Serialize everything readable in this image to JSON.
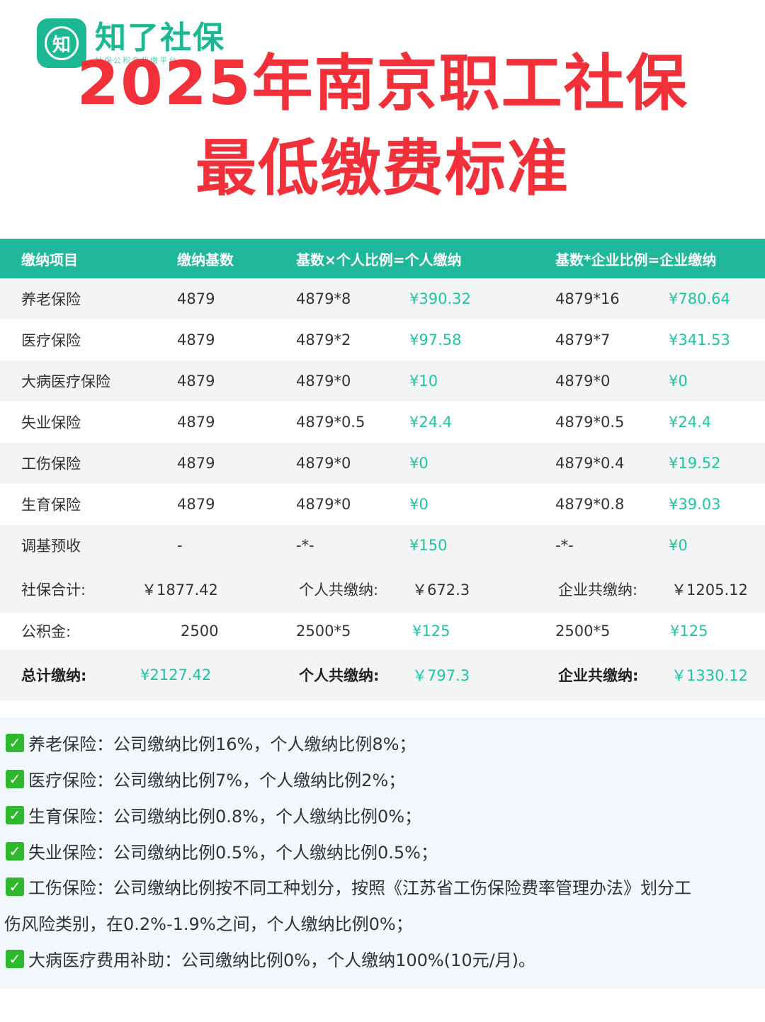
{
  "logo": {
    "mark": "知",
    "name": "知了社保",
    "slogan": "社保公积金代缴平台"
  },
  "title": {
    "line1": "2025年南京职工社保",
    "line2": "最低缴费标准"
  },
  "table": {
    "headers": [
      "缴纳项目",
      "缴纳基数",
      "基数×个人比例=个人缴纳",
      "基数*企业比例=企业缴纳"
    ],
    "rows": [
      {
        "item": "养老保险",
        "base": "4879",
        "p_formula": "4879*8",
        "p_amount": "¥390.32",
        "c_formula": "4879*16",
        "c_amount": "¥780.64"
      },
      {
        "item": "医疗保险",
        "base": "4879",
        "p_formula": "4879*2",
        "p_amount": "¥97.58",
        "c_formula": "4879*7",
        "c_amount": "¥341.53"
      },
      {
        "item": "大病医疗保险",
        "base": "4879",
        "p_formula": "4879*0",
        "p_amount": "¥10",
        "c_formula": "4879*0",
        "c_amount": "¥0"
      },
      {
        "item": "失业保险",
        "base": "4879",
        "p_formula": "4879*0.5",
        "p_amount": "¥24.4",
        "c_formula": "4879*0.5",
        "c_amount": "¥24.4"
      },
      {
        "item": "工伤保险",
        "base": "4879",
        "p_formula": "4879*0",
        "p_amount": "¥0",
        "c_formula": "4879*0.4",
        "c_amount": "¥19.52"
      },
      {
        "item": "生育保险",
        "base": "4879",
        "p_formula": "4879*0",
        "p_amount": "¥0",
        "c_formula": "4879*0.8",
        "c_amount": "¥39.03"
      },
      {
        "item": "调基预收",
        "base": "-",
        "p_formula": "-*-",
        "p_amount": "¥150",
        "c_formula": "-*-",
        "c_amount": "¥0"
      }
    ],
    "social_total": {
      "label": "社保合计:",
      "value": "￥1877.42",
      "personal_label": "个人共缴纳:",
      "personal_value": "￥672.3",
      "company_label": "企业共缴纳:",
      "company_value": "￥1205.12"
    },
    "housing_fund": {
      "label": "公积金:",
      "base": "2500",
      "p_formula": "2500*5",
      "p_amount": "¥125",
      "c_formula": "2500*5",
      "c_amount": "¥125"
    },
    "grand_total": {
      "label": "总计缴纳:",
      "value": "¥2127.42",
      "personal_label": "个人共缴纳:",
      "personal_value": "￥797.3",
      "company_label": "企业共缴纳:",
      "company_value": "￥1330.12"
    }
  },
  "notes": [
    "养老保险：公司缴纳比例16%，个人缴纳比例8%；",
    "医疗保险：公司缴纳比例7%，个人缴纳比例2%；",
    "生育保险：公司缴纳比例0.8%，个人缴纳比例0%；",
    "失业保险：公司缴纳比例0.5%，个人缴纳比例0.5%；",
    "工伤保险：公司缴纳比例按不同工种划分，按照《江苏省工伤保险费率管理办法》划分工",
    "伤风险类别，在0.2%-1.9%之间，个人缴纳比例0%；",
    "大病医疗费用补助：公司缴纳比例0%，个人缴纳100%(10元/月)。"
  ],
  "check_mark": "✓"
}
